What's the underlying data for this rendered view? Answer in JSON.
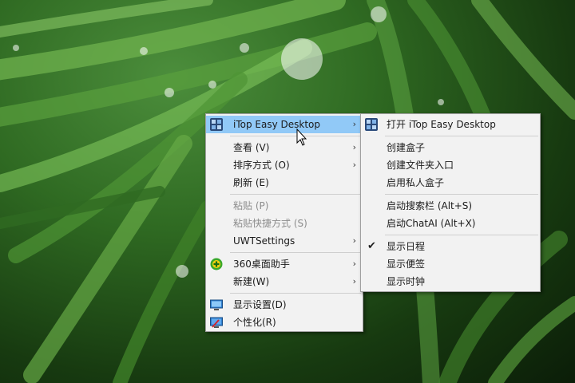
{
  "main_menu": {
    "items": [
      {
        "label": "iTop Easy Desktop"
      },
      {
        "label": "查看 (V)"
      },
      {
        "label": "排序方式 (O)"
      },
      {
        "label": "刷新 (E)"
      },
      {
        "label": "粘贴 (P)"
      },
      {
        "label": "粘贴快捷方式 (S)"
      },
      {
        "label": "UWTSettings"
      },
      {
        "label": "360桌面助手"
      },
      {
        "label": "新建(W)"
      },
      {
        "label": "显示设置(D)"
      },
      {
        "label": "个性化(R)"
      }
    ]
  },
  "sub_menu": {
    "items": [
      {
        "label": "打开 iTop Easy Desktop"
      },
      {
        "label": "创建盒子"
      },
      {
        "label": "创建文件夹入口"
      },
      {
        "label": "启用私人盒子"
      },
      {
        "label": "启动搜索栏 (Alt+S)"
      },
      {
        "label": "启动ChatAI (Alt+X)"
      },
      {
        "label": "显示日程"
      },
      {
        "label": "显示便签"
      },
      {
        "label": "显示时钟"
      }
    ]
  },
  "colors": {
    "menu_bg": "#f2f2f2",
    "highlight": "#91c9f7",
    "disabled_text": "#8c8c8c"
  },
  "icons": {
    "itop": "itop-easy-desktop-icon",
    "plugin360": "360-assistant-icon",
    "display": "display-settings-icon",
    "personalize": "personalize-icon",
    "check": "checkmark-icon"
  }
}
